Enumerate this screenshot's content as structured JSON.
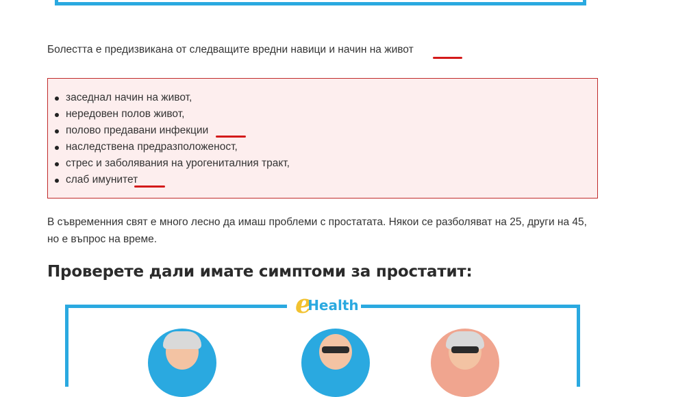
{
  "intro_text": "Болестта е предизвикана от следващите вредни навици и начин на живот",
  "causes": [
    "заседнал начин на живот,",
    "нередовен полов живот,",
    "полово предавани инфекции",
    "наследствена предразположеност,",
    "стрес и заболявания на урогениталния тракт,",
    "слаб имунитет"
  ],
  "paragraph": "В съвременния свят е много лесно да имаш проблеми с простатата. Някои се разболяват на 25, други на 45, но е въпрос на време.",
  "heading": "Проверете дали имате симптоми за простатит:",
  "logo": {
    "letter": "e",
    "word": "Health"
  },
  "colors": {
    "frame": "#2aa9e0",
    "callout_bg": "#fdeeee",
    "callout_border": "#c02a2a",
    "underline": "#d31a1a",
    "logo_yellow": "#f2c230"
  }
}
